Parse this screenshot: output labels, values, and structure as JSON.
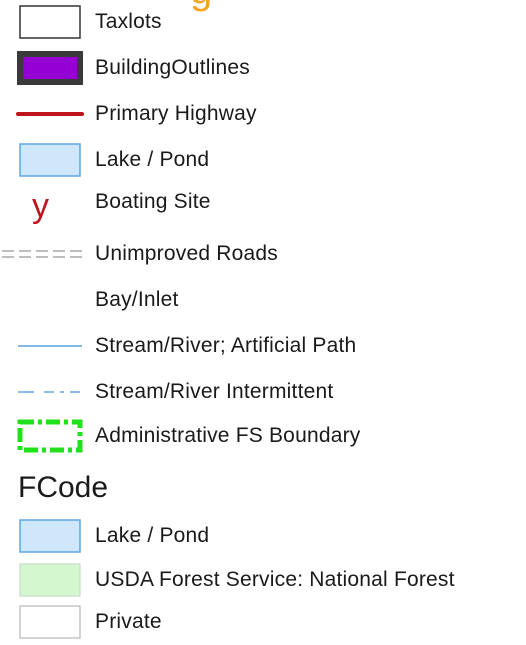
{
  "clipped_heading": "g",
  "legend_items": [
    {
      "label": "Taxlots",
      "icon": "taxlots-swatch-icon"
    },
    {
      "label": "BuildingOutlines",
      "icon": "building-outline-swatch-icon"
    },
    {
      "label": "Primary Highway",
      "icon": "primary-highway-line-icon"
    },
    {
      "label": "Lake / Pond",
      "icon": "lake-pond-swatch-icon"
    },
    {
      "label": "Boating Site",
      "icon": "boating-site-glyph-icon",
      "glyph": "y"
    },
    {
      "label": "Unimproved Roads",
      "icon": "unimproved-roads-line-icon"
    },
    {
      "label": "Bay/Inlet",
      "icon": ""
    },
    {
      "label": "Stream/River; Artificial Path",
      "icon": "stream-river-line-icon"
    },
    {
      "label": "Stream/River Intermittent",
      "icon": "stream-intermittent-line-icon"
    },
    {
      "label": "Administrative FS Boundary",
      "icon": "fs-boundary-swatch-icon"
    }
  ],
  "fcode": {
    "heading": "FCode",
    "items": [
      {
        "label": "Lake / Pond",
        "icon": "fcode-lake-pond-swatch-icon"
      },
      {
        "label": "USDA Forest Service: National Forest",
        "icon": "fcode-national-forest-swatch-icon"
      },
      {
        "label": "Private",
        "icon": "fcode-private-swatch-icon"
      }
    ]
  },
  "colors": {
    "taxlots_fill": "#ffffff",
    "taxlots_stroke": "#333333",
    "building_fill": "#9400d3",
    "building_stroke": "#3a3a3a",
    "highway": "#c0141c",
    "lake_fill": "#cfe6fb",
    "lake_stroke": "#5aa8e6",
    "boating_glyph": "#c0141c",
    "unimproved_roads": "#a8a8a8",
    "stream": "#3f8ed8",
    "fs_boundary": "#22e01a",
    "forest_fill": "#d4f7d0",
    "forest_stroke": "#c8ddc8",
    "private_fill": "#ffffff",
    "private_stroke": "#b8b8b8"
  }
}
